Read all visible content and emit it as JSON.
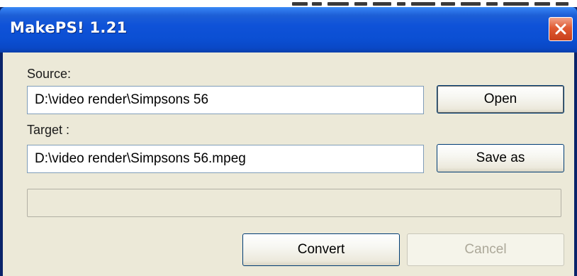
{
  "window": {
    "title": "MakePS! 1.21"
  },
  "source": {
    "label": "Source:",
    "value": "D:\\video render\\Simpsons 56",
    "button": "Open"
  },
  "target": {
    "label": "Target :",
    "value": "D:\\video render\\Simpsons 56.mpeg",
    "button": "Save as"
  },
  "progress": {
    "fraction": 0
  },
  "actions": {
    "convert": "Convert",
    "cancel": "Cancel"
  },
  "icons": {
    "close": "close-icon"
  },
  "colors": {
    "titlebar": "#0b4fd3",
    "close_button": "#e05a33",
    "dialog_face": "#ece9d8",
    "field_border": "#7f9db9",
    "button_border": "#003c74",
    "disabled_text": "#aca899"
  }
}
